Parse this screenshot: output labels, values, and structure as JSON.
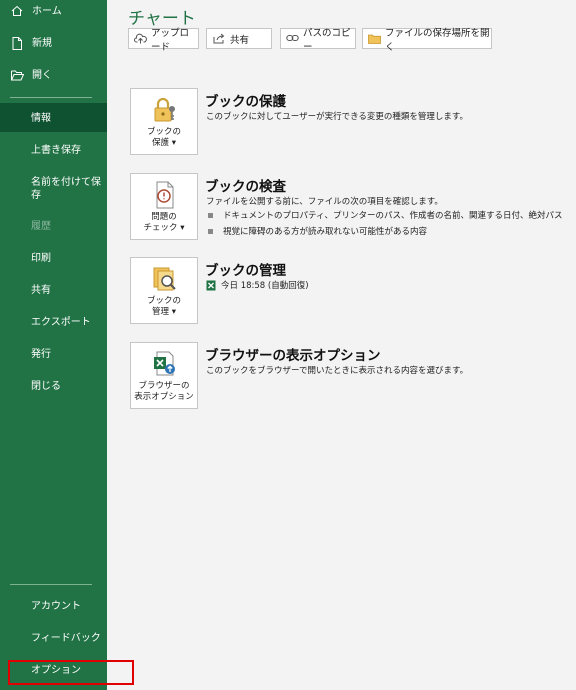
{
  "sidebar": {
    "home": "ホーム",
    "new": "新規",
    "open": "開く",
    "info": "情報",
    "save": "上書き保存",
    "save_as": "名前を付けて保\n存",
    "history": "履歴",
    "print": "印刷",
    "share": "共有",
    "export": "エクスポート",
    "publish": "発行",
    "close": "閉じる",
    "account": "アカウント",
    "feedback": "フィードバック",
    "options": "オプション"
  },
  "header": {
    "title": "チャート"
  },
  "toolbar": {
    "upload": "アップロード",
    "share": "共有",
    "copy_path": "パスのコピー",
    "open_location": "ファイルの保存場所を開く"
  },
  "sections": {
    "protect": {
      "tile_label": "ブックの\n保護 ▾",
      "title": "ブックの保護",
      "desc": "このブックに対してユーザーが実行できる変更の種類を管理します。"
    },
    "inspect": {
      "tile_label": "問題の\nチェック ▾",
      "title": "ブックの検査",
      "desc": "ファイルを公開する前に、ファイルの次の項目を確認します。",
      "bullets": [
        "ドキュメントのプロパティ、プリンターのパス、作成者の名前、関連する日付、絶対パス",
        "視覚に障碍のある方が読み取れない可能性がある内容"
      ]
    },
    "manage": {
      "tile_label": "ブックの\n管理 ▾",
      "title": "ブックの管理",
      "autosave": "今日 18:58 (自動回復)"
    },
    "browser": {
      "tile_label": "ブラウザーの\n表示オプション",
      "title": "ブラウザーの表示オプション",
      "desc": "このブックをブラウザーで開いたときに表示される内容を選びます。"
    }
  },
  "colors": {
    "sidebar": "#217346",
    "sidebar_selected": "#0f5231",
    "accent_title": "#217346",
    "highlight": "#e00000"
  }
}
